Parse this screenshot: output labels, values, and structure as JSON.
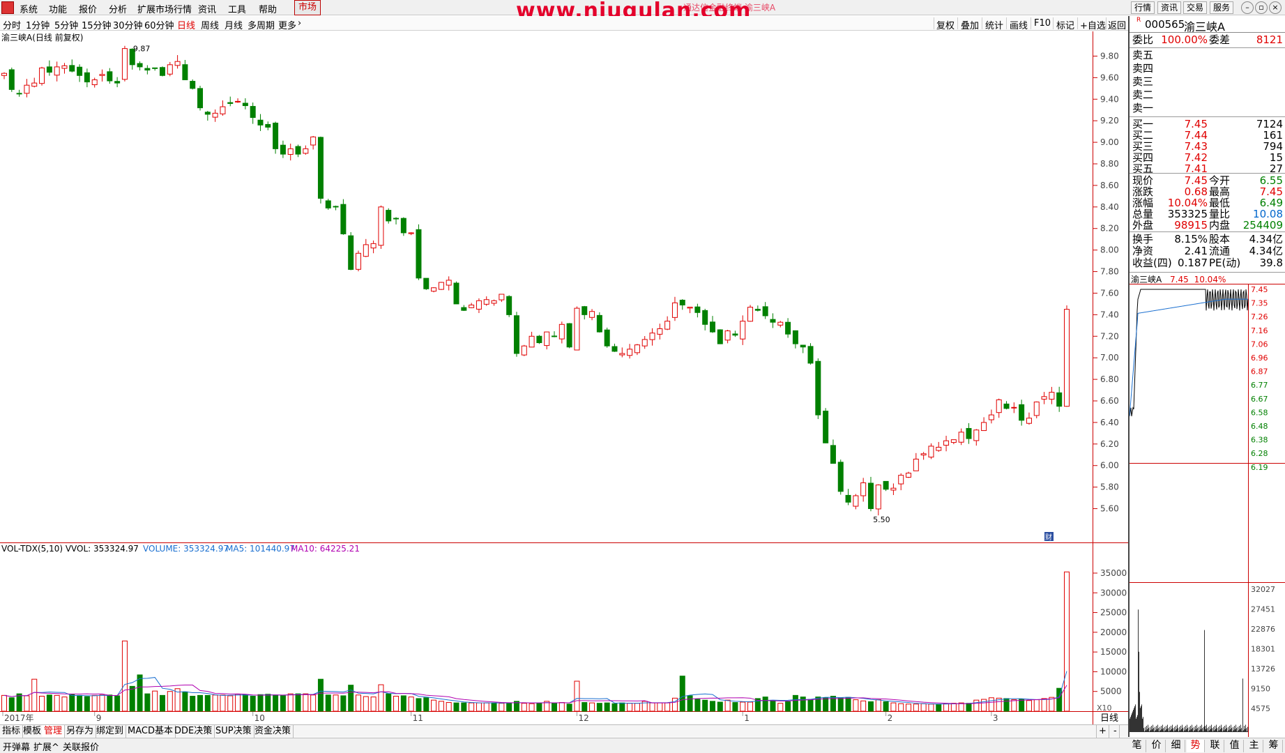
{
  "menu": {
    "items": [
      "系统",
      "功能",
      "报价",
      "分析",
      "扩展市场行情",
      "资讯",
      "工具",
      "帮助"
    ],
    "market": "市场",
    "right_buttons": [
      "行情",
      "资讯",
      "交易",
      "服务"
    ],
    "watermark": "www.niugulan.com",
    "window_title": "通达信金融终端 渝三峡A"
  },
  "timeframes": [
    "分时",
    "1分钟",
    "5分钟",
    "15分钟",
    "30分钟",
    "60分钟",
    "日线",
    "周线",
    "月线",
    "多周期",
    "更多"
  ],
  "active_timeframe": "日线",
  "tools": [
    "复权",
    "叠加",
    "统计",
    "画线",
    "F10",
    "标记",
    "+自选",
    "返回"
  ],
  "chart": {
    "title": "渝三峡A(日线 前复权)",
    "high_label": "9.87",
    "low_label": "5.50",
    "y_ticks": [
      "9.80",
      "9.60",
      "9.40",
      "9.20",
      "9.00",
      "8.80",
      "8.60",
      "8.40",
      "8.20",
      "8.00",
      "7.80",
      "7.60",
      "7.40",
      "7.20",
      "7.00",
      "6.80",
      "6.60",
      "6.40",
      "6.20",
      "6.00",
      "5.80",
      "5.60"
    ],
    "x_labels": [
      "2017年",
      "9",
      "10",
      "11",
      "12",
      "1",
      "2",
      "3"
    ],
    "vol_title": "VOL-TDX(5,10) VVOL: 353324.97",
    "vol_volume": "VOLUME: 353324.97",
    "vol_ma5": "MA5: 101440.97",
    "vol_ma10": "MA10: 64225.21",
    "vol_ticks": [
      "35000",
      "30000",
      "25000",
      "20000",
      "15000",
      "10000",
      "5000"
    ],
    "vol_unit": "X10",
    "period_label": "日线",
    "small_badge": "财"
  },
  "chart_data": {
    "type": "candlestick",
    "closes": [
      9.64,
      9.49,
      9.45,
      9.53,
      9.55,
      9.69,
      9.65,
      9.7,
      9.71,
      9.66,
      9.62,
      9.56,
      9.58,
      9.63,
      9.57,
      9.55,
      9.87,
      9.72,
      9.7,
      9.67,
      9.69,
      9.62,
      9.72,
      9.75,
      9.58,
      9.5,
      9.32,
      9.26,
      9.27,
      9.33,
      9.36,
      9.38,
      9.34,
      9.23,
      9.16,
      9.14,
      8.94,
      8.89,
      8.94,
      8.89,
      8.94,
      9.05,
      8.48,
      8.39,
      8.4,
      8.15,
      7.82,
      7.97,
      8.05,
      8.06,
      8.4,
      8.27,
      8.29,
      8.16,
      8.16,
      7.74,
      7.64,
      7.65,
      7.7,
      7.72,
      7.5,
      7.44,
      7.49,
      7.53,
      7.54,
      7.53,
      7.59,
      7.4,
      7.04,
      7.11,
      7.2,
      7.14,
      7.24,
      7.2,
      7.31,
      7.1,
      7.46,
      7.4,
      7.43,
      7.24,
      7.11,
      7.06,
      7.04,
      7.08,
      7.12,
      7.17,
      7.23,
      7.27,
      7.34,
      7.51,
      7.49,
      7.47,
      7.42,
      7.31,
      7.24,
      7.13,
      7.25,
      7.21,
      7.34,
      7.47,
      7.44,
      7.39,
      7.33,
      7.33,
      7.22,
      7.13,
      7.1,
      6.95,
      6.47,
      6.21,
      6.02,
      5.76,
      5.66,
      5.72,
      5.84,
      5.6,
      5.82,
      5.78,
      5.79,
      5.91,
      5.93,
      6.06,
      6.11,
      6.18,
      6.17,
      6.23,
      6.24,
      6.31,
      6.25,
      6.33,
      6.4,
      6.47,
      6.61,
      6.53,
      6.54,
      6.42,
      6.44,
      6.59,
      6.64,
      6.68,
      6.55,
      7.45
    ],
    "volumes_x10": [
      4000,
      3400,
      4400,
      3900,
      8100,
      3800,
      4100,
      4000,
      3600,
      4300,
      4000,
      3700,
      4000,
      4100,
      4100,
      3900,
      17800,
      6300,
      9200,
      4400,
      5100,
      4000,
      5000,
      5700,
      4900,
      3800,
      4000,
      4000,
      4100,
      4100,
      3900,
      4300,
      4200,
      3800,
      4200,
      4300,
      4100,
      3900,
      4400,
      4400,
      4400,
      4100,
      8100,
      4100,
      4100,
      3900,
      6600,
      4100,
      3700,
      3600,
      6700,
      4400,
      3800,
      3900,
      3600,
      3200,
      3400,
      2800,
      2500,
      2200,
      2100,
      2100,
      2100,
      2100,
      2100,
      2100,
      2000,
      2100,
      2500,
      2000,
      1900,
      2000,
      2500,
      2100,
      2200,
      1800,
      7600,
      2200,
      2100,
      2000,
      2100,
      1900,
      2100,
      2000,
      2000,
      2500,
      2100,
      2100,
      2100,
      3300,
      8900,
      3900,
      3000,
      2800,
      2500,
      2300,
      2800,
      2200,
      2300,
      2300,
      3200,
      3600,
      2600,
      2000,
      2400,
      4000,
      3600,
      3000,
      3600,
      3400,
      3800,
      3400,
      3500,
      2900,
      2600,
      2400,
      2900,
      2400,
      2100,
      1900,
      1800,
      1800,
      1900,
      1800,
      1700,
      1900,
      2000,
      2100,
      2000,
      2800,
      3000,
      3400,
      3300,
      3200,
      2900,
      3000,
      2700,
      2900,
      3200,
      3500,
      5800,
      35300
    ]
  },
  "quote": {
    "code": "000565",
    "name": "渝三峡A",
    "r_mark": "R",
    "weibi_label": "委比",
    "weibi_val": "100.00%",
    "weicha_label": "委差",
    "weicha_val": "8121",
    "sells": [
      {
        "label": "卖五"
      },
      {
        "label": "卖四"
      },
      {
        "label": "卖三"
      },
      {
        "label": "卖二"
      },
      {
        "label": "卖一"
      }
    ],
    "buys": [
      {
        "label": "买一",
        "price": "7.45",
        "vol": "7124"
      },
      {
        "label": "买二",
        "price": "7.44",
        "vol": "161"
      },
      {
        "label": "买三",
        "price": "7.43",
        "vol": "794"
      },
      {
        "label": "买四",
        "price": "7.42",
        "vol": "15"
      },
      {
        "label": "买五",
        "price": "7.41",
        "vol": "27"
      }
    ],
    "stats": [
      {
        "l1": "现价",
        "v1": "7.45",
        "c1": "red",
        "l2": "今开",
        "v2": "6.55",
        "c2": "green"
      },
      {
        "l1": "涨跌",
        "v1": "0.68",
        "c1": "red",
        "l2": "最高",
        "v2": "7.45",
        "c2": "red"
      },
      {
        "l1": "涨幅",
        "v1": "10.04%",
        "c1": "red",
        "l2": "最低",
        "v2": "6.49",
        "c2": "green"
      },
      {
        "l1": "总量",
        "v1": "353325",
        "c1": "black",
        "l2": "量比",
        "v2": "10.08",
        "c2": "blue"
      },
      {
        "l1": "外盘",
        "v1": "98915",
        "c1": "red",
        "l2": "内盘",
        "v2": "254409",
        "c2": "green"
      }
    ],
    "stats2": [
      {
        "l1": "换手",
        "v1": "8.15%",
        "l2": "股本",
        "v2": "4.34亿"
      },
      {
        "l1": "净资",
        "v1": "2.41",
        "l2": "流通",
        "v2": "4.34亿"
      },
      {
        "l1": "收益(四)",
        "v1": "0.187",
        "l2": "PE(动)",
        "v2": "39.8"
      }
    ],
    "mini_title": "渝三峡A",
    "mini_price": "7.45",
    "mini_pct": "10.04%",
    "mini_price_ticks": [
      "7.45",
      "7.35",
      "7.26",
      "7.16",
      "7.06",
      "6.96",
      "6.87",
      "6.77",
      "6.67",
      "6.58",
      "6.48",
      "6.38",
      "6.28",
      "6.19"
    ],
    "mini_vol_ticks": [
      "32027",
      "27451",
      "22876",
      "18301",
      "13726",
      "9150",
      "4575"
    ]
  },
  "bottom_tabs": [
    "指标",
    "模板",
    "管理",
    "另存为",
    "绑定到",
    "MACD基本",
    "DDE决策",
    "SUP决策",
    "资金决策"
  ],
  "active_bottom_tab": "管理",
  "status": {
    "left": [
      "开弹幕",
      "扩展^",
      "关联报价"
    ],
    "right_tabs": [
      "笔",
      "价",
      "细",
      "势",
      "联",
      "值",
      "主",
      "筹"
    ],
    "active_right_tab": "势"
  }
}
